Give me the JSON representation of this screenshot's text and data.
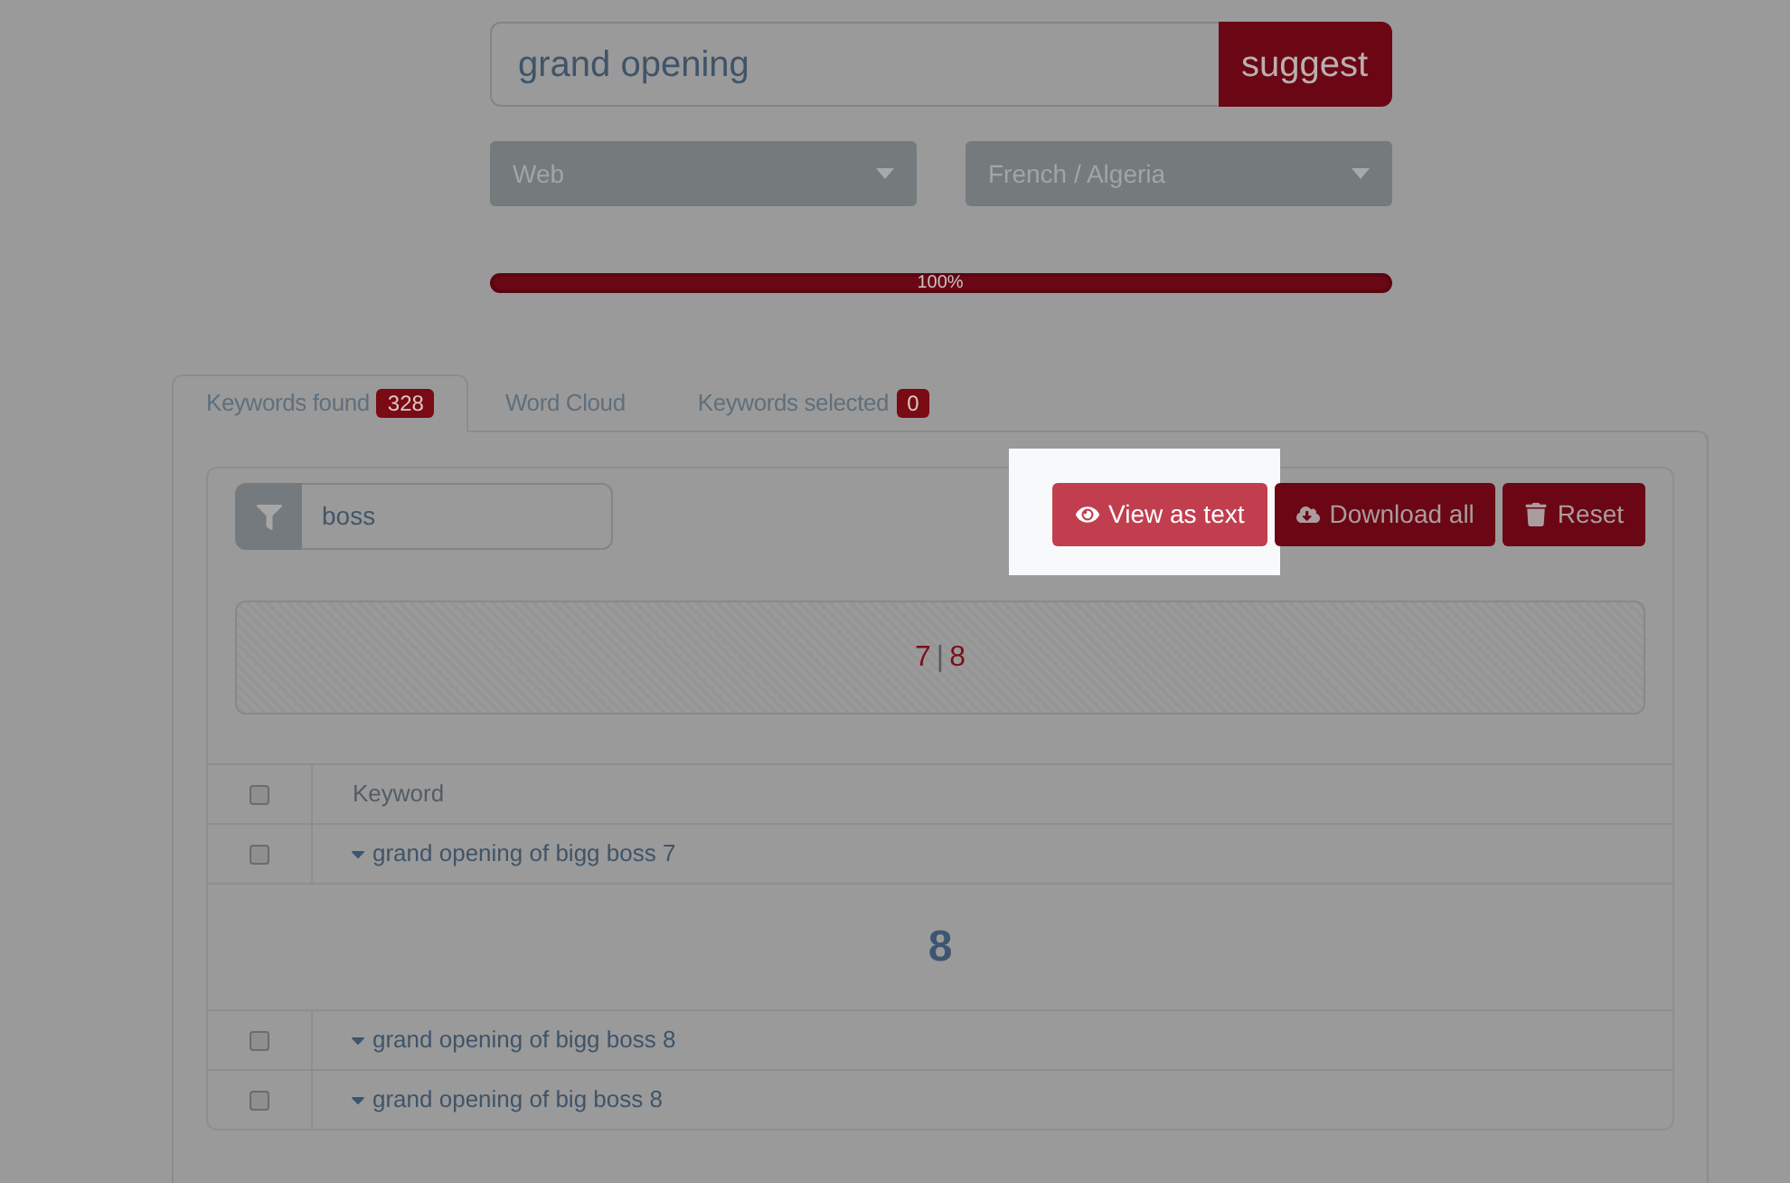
{
  "search": {
    "value": "grand opening",
    "button": "suggest"
  },
  "selects": [
    {
      "value": "Web"
    },
    {
      "value": "French / Algeria"
    }
  ],
  "progress": {
    "level": 1,
    "label": "100%"
  },
  "tabs": [
    {
      "label": "Keywords found",
      "badge": "328",
      "selected": true
    },
    {
      "label": "Word Cloud",
      "selected": false
    },
    {
      "label": "Keywords selected",
      "badge": "0",
      "selected": false
    }
  ],
  "filter": {
    "value": "boss"
  },
  "actions": [
    {
      "label": "View as text",
      "highlighted": true
    },
    {
      "label": "Download all",
      "highlighted": false
    },
    {
      "label": "Reset",
      "highlighted": false
    }
  ],
  "pager": {
    "items": [
      "7",
      "8"
    ],
    "separator": "|"
  },
  "table": {
    "header": {
      "checked": false,
      "label": "Keyword"
    },
    "rows": [
      {
        "kind": "keyword",
        "checked": false,
        "text": "grand opening of bigg boss 7"
      },
      {
        "kind": "group",
        "text": "8"
      },
      {
        "kind": "keyword",
        "checked": false,
        "text": "grand opening of bigg boss 8"
      },
      {
        "kind": "keyword",
        "checked": false,
        "text": "grand opening of big boss 8"
      }
    ]
  }
}
